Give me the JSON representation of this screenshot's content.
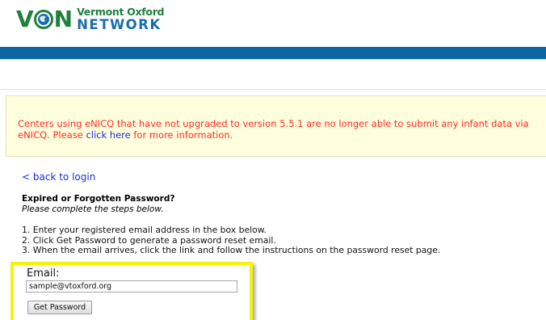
{
  "logo": {
    "mark": "VON",
    "org_line1": "Vermont Oxford",
    "org_line2": "NETWORK",
    "colors": {
      "green": "#1f7f3d",
      "blue": "#1b6ea8"
    }
  },
  "colors": {
    "header_bar": "#0a67a3",
    "notice_bg": "#ffffdd",
    "notice_text": "#ff2a2a",
    "link": "#1a2fd8",
    "highlight": "#f7f20a"
  },
  "notice": {
    "text_before": "Centers using eNICQ that have not upgraded to version 5.5.1 are no longer able to submit any infant data via eNICQ. Please ",
    "link_text": "click here",
    "text_after": " for more information."
  },
  "nav": {
    "back_link": "< back to login"
  },
  "form": {
    "heading": "Expired or Forgotten Password?",
    "subheading": "Please complete the steps below.",
    "steps": [
      "1. Enter your registered email address in the box below.",
      "2. Click Get Password to generate a password reset email.",
      "3. When the email arrives, click the link and follow the instructions on the password reset page."
    ],
    "email_label": "Email:",
    "email_value": "sample@vtoxford.org",
    "button_label": "Get Password"
  }
}
